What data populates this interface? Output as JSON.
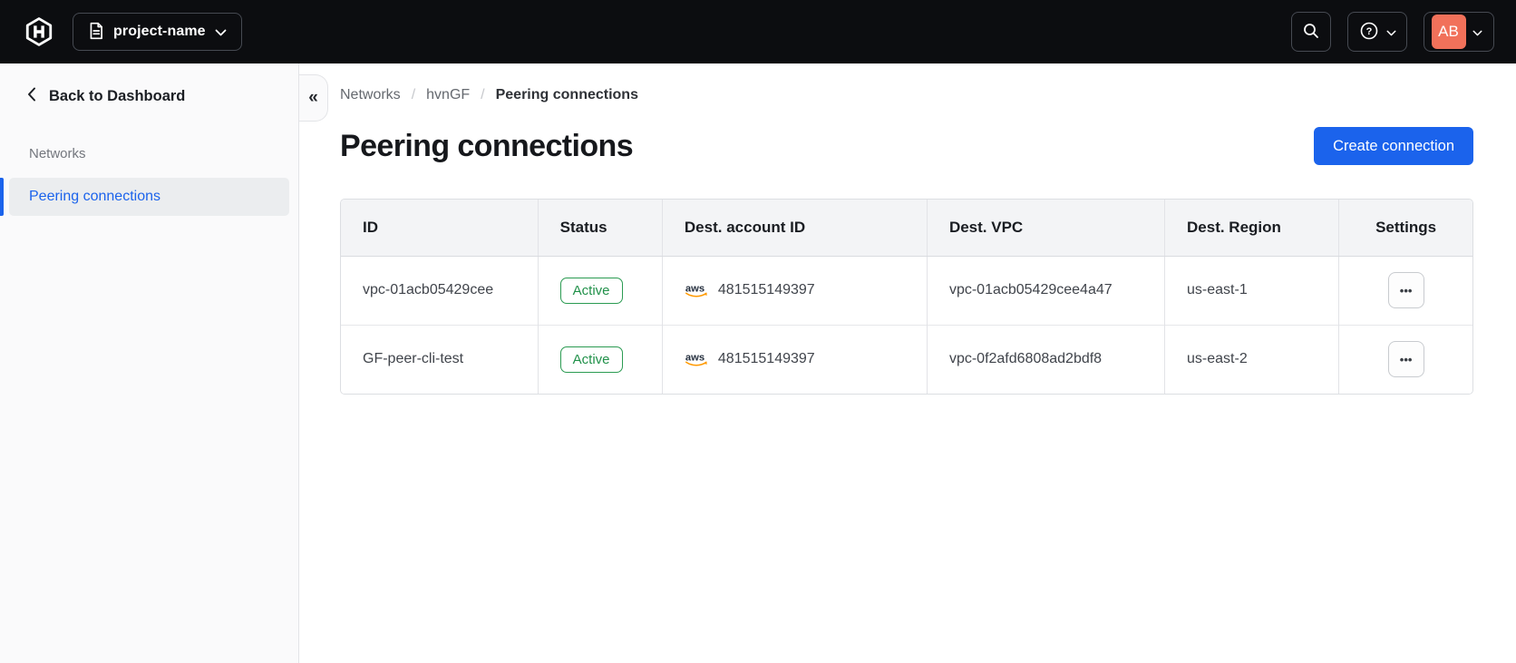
{
  "topbar": {
    "project": {
      "label": "project-name"
    },
    "avatar": {
      "initials": "AB"
    }
  },
  "sidebar": {
    "back_label": "Back to Dashboard",
    "section": "Networks",
    "items": [
      {
        "label": "Peering connections",
        "active": true
      }
    ],
    "collapse_glyph": "«"
  },
  "breadcrumb": {
    "separator": "/",
    "items": [
      {
        "label": "Networks"
      },
      {
        "label": "hvnGF"
      },
      {
        "label": "Peering connections"
      }
    ]
  },
  "page": {
    "title": "Peering connections",
    "create_button": "Create connection"
  },
  "table": {
    "columns": [
      "ID",
      "Status",
      "Dest. account ID",
      "Dest. VPC",
      "Dest. Region",
      "Settings"
    ],
    "rows": [
      {
        "id": "vpc-01acb05429cee",
        "status": "Active",
        "provider": "aws",
        "dest_account_id": "481515149397",
        "dest_vpc": "vpc-01acb05429cee4a47",
        "dest_region": "us-east-1"
      },
      {
        "id": "GF-peer-cli-test",
        "status": "Active",
        "provider": "aws",
        "dest_account_id": "481515149397",
        "dest_vpc": "vpc-0f2afd6808ad2bdf8",
        "dest_region": "us-east-2"
      }
    ]
  },
  "icons": {
    "ellipsis": "•••",
    "back_chevron": "‹"
  },
  "colors": {
    "topbar_bg": "#0C0D10",
    "accent_blue": "#1B63EC",
    "success_green": "#2B9B52",
    "avatar_bg": "#F1715A",
    "aws_orange": "#FF9900",
    "sidebar_bg": "#FAFAFB"
  }
}
